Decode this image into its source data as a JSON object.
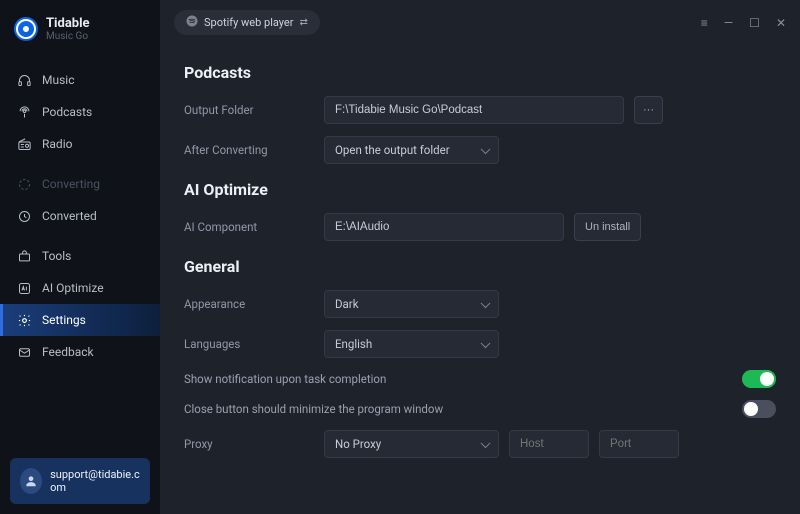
{
  "brand": {
    "name": "Tidable",
    "sub": "Music Go"
  },
  "topbar": {
    "source": "Spotify web player"
  },
  "sidebar": {
    "items": [
      {
        "label": "Music"
      },
      {
        "label": "Podcasts"
      },
      {
        "label": "Radio"
      },
      {
        "label": "Converting"
      },
      {
        "label": "Converted"
      },
      {
        "label": "Tools"
      },
      {
        "label": "AI Optimize"
      },
      {
        "label": "Settings"
      },
      {
        "label": "Feedback"
      }
    ],
    "support": "support@tidabie.com"
  },
  "sections": {
    "podcasts": {
      "title": "Podcasts",
      "output_folder_label": "Output Folder",
      "output_folder_value": "F:\\Tidabie Music Go\\Podcast",
      "browse_btn": "···",
      "after_converting_label": "After Converting",
      "after_converting_value": "Open the output folder"
    },
    "ai": {
      "title": "AI Optimize",
      "component_label": "AI Component",
      "component_value": "E:\\AIAudio",
      "uninstall_btn": "Un install"
    },
    "general": {
      "title": "General",
      "appearance_label": "Appearance",
      "appearance_value": "Dark",
      "languages_label": "Languages",
      "languages_value": "English",
      "notif_label": "Show notification upon task completion",
      "close_label": "Close button should minimize the program window",
      "proxy_label": "Proxy",
      "proxy_value": "No Proxy",
      "host_placeholder": "Host",
      "port_placeholder": "Port"
    }
  },
  "toggles": {
    "notification": true,
    "close_minimize": false
  }
}
